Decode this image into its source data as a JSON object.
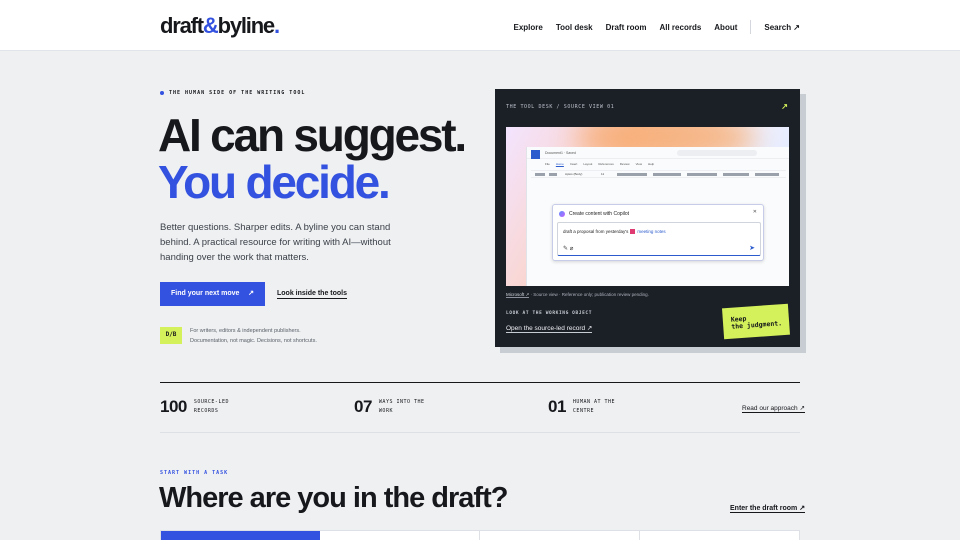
{
  "header": {
    "logo": {
      "part1": "draft",
      "amp": "&",
      "part2": "byline",
      "dot": "."
    },
    "nav": [
      "Explore",
      "Tool desk",
      "Draft room",
      "All records",
      "About"
    ],
    "search": "Search ↗"
  },
  "hero": {
    "eyebrow": "THE HUMAN SIDE OF THE WRITING TOOL",
    "title_line1": "AI can suggest.",
    "title_line2": "You decide.",
    "lede": "Better questions. Sharper edits. A byline you can stand behind. A practical resource for writing with AI—without handing over the work that matters.",
    "cta_primary": "Find your next move",
    "cta_primary_arrow": "↗",
    "cta_secondary": "Look inside the tools",
    "badge": "D/B",
    "note_line1": "For writers, editors & independent publishers.",
    "note_line2": "Documentation, not magic. Decisions, not shortcuts."
  },
  "card": {
    "label": "THE TOOL DESK / SOURCE VIEW 01",
    "arrow": "↗",
    "screenshot": {
      "doc_title": "Document1 · Saved",
      "tabs": [
        "File",
        "Home",
        "Insert",
        "Layout",
        "References",
        "Review",
        "View",
        "Help"
      ],
      "font": "Aptos (Body)",
      "font_size": "11",
      "dialog_title": "Create content with Copilot",
      "close": "✕",
      "prompt_before": "draft a proposal from yesterday's",
      "prompt_ref": "meeting notes",
      "tools": "✎ ⌀",
      "send": "➤"
    },
    "caption_source": "Microsoft ↗",
    "caption_rest": " · Source view · Reference only; publication review pending.",
    "look": "LOOK AT THE WORKING OBJECT",
    "open_link": "Open the source-led record ↗",
    "sticker_line1": "Keep",
    "sticker_line2": "the judgment."
  },
  "stats": [
    {
      "num": "100",
      "label": "SOURCE-LED RECORDS"
    },
    {
      "num": "07",
      "label": "WAYS INTO THE WORK"
    },
    {
      "num": "01",
      "label": "HUMAN AT THE CENTRE"
    }
  ],
  "read_link": "Read our approach ↗",
  "section": {
    "eyebrow": "START WITH A TASK",
    "title": "Where are you in the draft?",
    "enter_link": "Enter the draft room ↗"
  },
  "colors": {
    "accent": "#3452e0",
    "highlight": "#d4f05a",
    "dark": "#1b1f26"
  }
}
